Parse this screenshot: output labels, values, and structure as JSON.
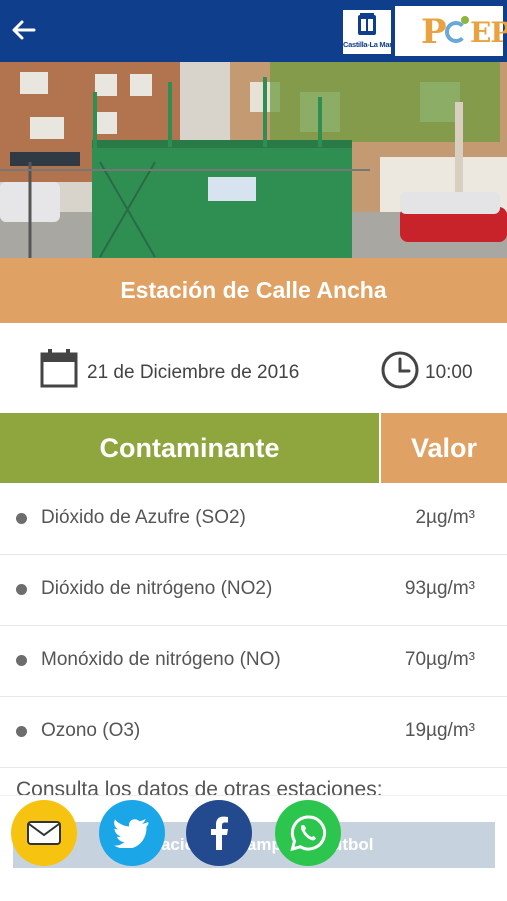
{
  "header": {
    "back_icon": "arrow-left-icon",
    "logo_region_text": "Castilla-La Mancha",
    "logo_pcep_text": "P  EP"
  },
  "station": {
    "title": "Estación de Calle Ancha",
    "date": "21 de Diciembre de 2016",
    "time": "10:00"
  },
  "table": {
    "col_pollutant": "Contaminante",
    "col_value": "Valor",
    "rows": [
      {
        "name": "Dióxido de Azufre (SO2)",
        "value": "2µg/m³"
      },
      {
        "name": "Dióxido de nitrógeno (NO2)",
        "value": "93µg/m³"
      },
      {
        "name": "Monóxido de nitrógeno (NO)",
        "value": "70µg/m³"
      },
      {
        "name": "Ozono (O3)",
        "value": "19µg/m³"
      }
    ]
  },
  "footer": {
    "consult_text": "Consulta los datos de otras estaciones:",
    "station_button": "Estación de Campo de Fútbol"
  },
  "share": {
    "icons": [
      "mail-icon",
      "twitter-icon",
      "facebook-icon",
      "whatsapp-icon"
    ]
  },
  "colors": {
    "topbar": "#0f3f8c",
    "banner": "#dfa264",
    "pollutant_header": "#8fa63e",
    "value_header": "#dfa264"
  }
}
